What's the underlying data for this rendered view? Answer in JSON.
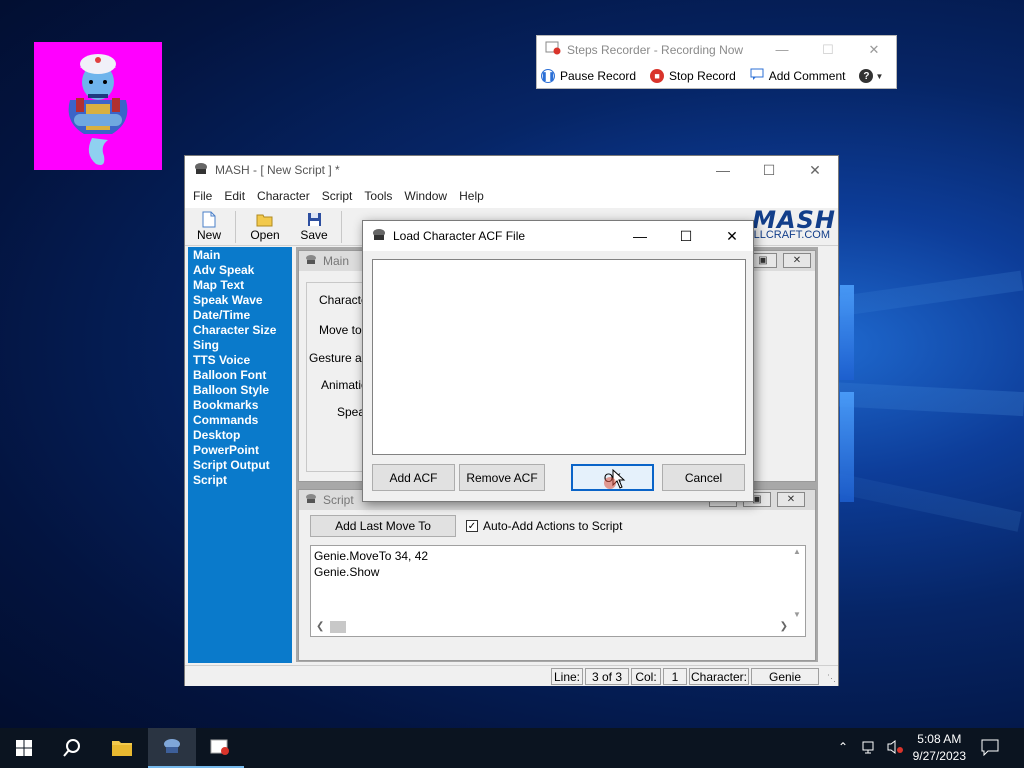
{
  "steps_recorder": {
    "title": "Steps Recorder - Recording Now",
    "pause_label": "Pause Record",
    "stop_label": "Stop Record",
    "comment_label": "Add Comment",
    "help_glyph": "?"
  },
  "mash": {
    "title": "MASH - [ New Script ] *",
    "menu": [
      "File",
      "Edit",
      "Character",
      "Script",
      "Tools",
      "Window",
      "Help"
    ],
    "toolbar": {
      "new": "New",
      "open": "Open",
      "save": "Save"
    },
    "logo": {
      "mark": "MASH",
      "url": "ELLCRAFT.COM"
    },
    "nav_items": [
      "Main",
      "Adv Speak",
      "Map Text",
      "Speak Wave",
      "Date/Time",
      "Character Size",
      "Sing",
      "TTS Voice",
      "Balloon Font",
      "Balloon Style",
      "Bookmarks",
      "Commands",
      "Desktop",
      "PowerPoint",
      "Script Output",
      "Script"
    ],
    "main_child": {
      "title": "Main",
      "labels": [
        "Characte",
        "Move to",
        "Gesture at",
        "Animatio",
        "Spea"
      ]
    },
    "script_child": {
      "title": "Script",
      "add_last_move_label": "Add Last Move To",
      "auto_add_label": "Auto-Add Actions to Script",
      "script_lines": [
        "Genie.MoveTo 34, 42",
        "Genie.Show"
      ]
    },
    "status": {
      "line_label": "Line:",
      "line_value": "3 of 3",
      "col_label": "Col:",
      "col_value": "1",
      "character_label": "Character:",
      "character_value": "Genie"
    }
  },
  "dialog": {
    "title": "Load Character ACF File",
    "add_label": "Add ACF",
    "remove_label": "Remove ACF",
    "ok_label": "OK",
    "cancel_label": "Cancel"
  },
  "taskbar": {
    "time": "5:08 AM",
    "date": "9/27/2023"
  },
  "colors": {
    "nav_blue": "#0a7acb",
    "genie_bg": "#ff00ff",
    "stop_red": "#d9342b",
    "pause_blue": "#2b6fd6"
  }
}
